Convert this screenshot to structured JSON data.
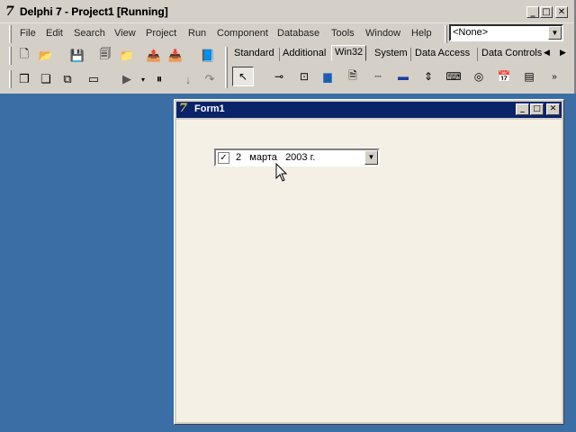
{
  "ide": {
    "title_prefix": "Delphi 7 - Project1",
    "title_suffix": "[Running]",
    "logo": "7",
    "menu": [
      "File",
      "Edit",
      "Search",
      "View",
      "Project",
      "Run",
      "Component",
      "Database",
      "Tools",
      "Window",
      "Help"
    ],
    "combo_value": "<None>",
    "palette_tabs": [
      "Standard",
      "Additional",
      "Win32",
      "System",
      "Data Access",
      "Data Controls"
    ],
    "active_tab": "Win32"
  },
  "form": {
    "caption": "Form1",
    "logo": "7",
    "datetime": {
      "checked": true,
      "check_glyph": "✓",
      "day": "2",
      "month": "марта",
      "year": "2003 г.",
      "dropdown_glyph": "▼"
    }
  },
  "window_buttons": {
    "minimize": "_",
    "maximize": "□",
    "close": "✕"
  },
  "icons": [
    "new-items-icon",
    "open-icon",
    "save-icon",
    "save-all-icon",
    "open-project-icon",
    "add-to-project-icon",
    "remove-from-project-icon",
    "help-icon",
    "view-unit-icon",
    "view-form-icon",
    "toggle-form-unit-icon",
    "new-form-icon",
    "run-icon",
    "pause-icon",
    "trace-into-icon",
    "step-over-icon"
  ]
}
